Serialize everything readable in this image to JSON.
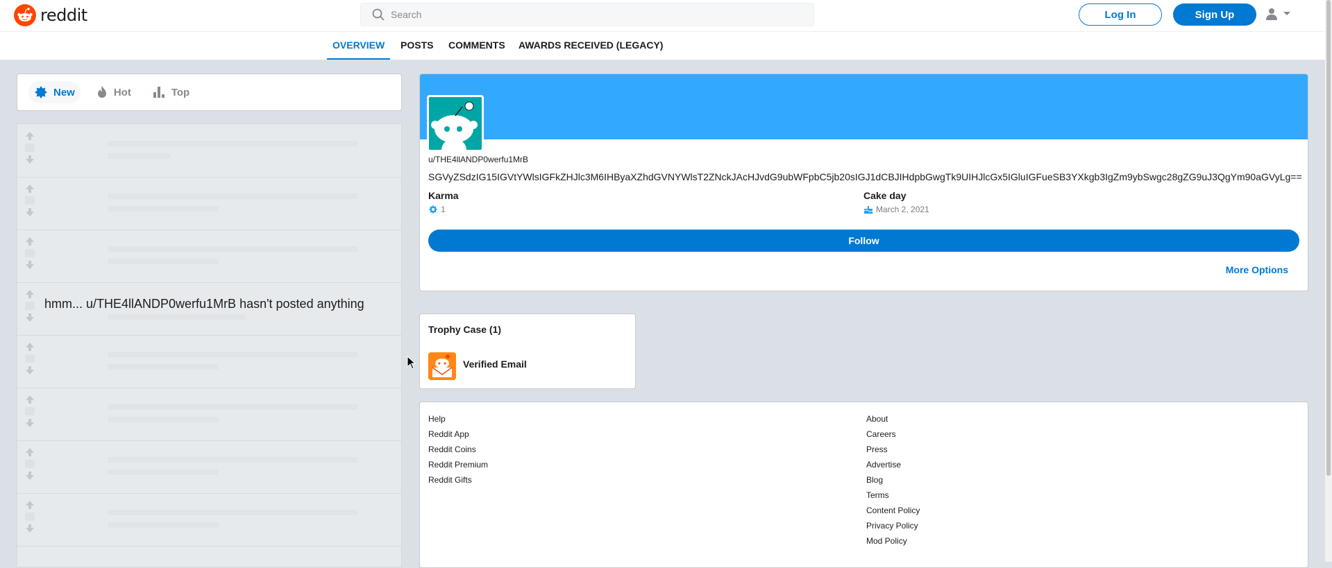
{
  "header": {
    "logo_text": "reddit",
    "search_placeholder": "Search",
    "login_label": "Log In",
    "signup_label": "Sign Up"
  },
  "tabs": [
    "OVERVIEW",
    "POSTS",
    "COMMENTS",
    "AWARDS RECEIVED (LEGACY)"
  ],
  "sort": {
    "new": "New",
    "hot": "Hot",
    "top": "Top"
  },
  "feed": {
    "empty_message": "hmm... u/THE4llANDP0werfu1MrB hasn't posted anything"
  },
  "profile": {
    "username": "u/THE4llANDP0werfu1MrB",
    "bio": "SGVyZSdzIG15IGVtYWlsIGFkZHJlc3M6IHByaXZhdGVNYWlsT2ZNckJAcHJvdG9ubWFpbC5jb20sIGJ1dCBJIHdpbGwgTk9UIHJlcGx5IGluIGFueSB3YXkgb3IgZm9ybSwgc28gZG9uJ3QgYm90aGVyLg==",
    "karma_label": "Karma",
    "karma_value": "1",
    "cake_label": "Cake day",
    "cake_value": "March 2, 2021",
    "follow_label": "Follow",
    "more_options_label": "More Options",
    "accent_color": "#0079d3",
    "banner_color": "#33a8ff"
  },
  "trophy_case": {
    "title": "Trophy Case (1)",
    "items": [
      {
        "name": "Verified Email",
        "icon": "verified-email-trophy-icon"
      }
    ]
  },
  "footer": {
    "left_links": [
      "Help",
      "Reddit App",
      "Reddit Coins",
      "Reddit Premium",
      "Reddit Gifts"
    ],
    "right_links": [
      "About",
      "Careers",
      "Press",
      "Advertise",
      "Blog",
      "Terms",
      "Content Policy",
      "Privacy Policy",
      "Mod Policy"
    ]
  }
}
